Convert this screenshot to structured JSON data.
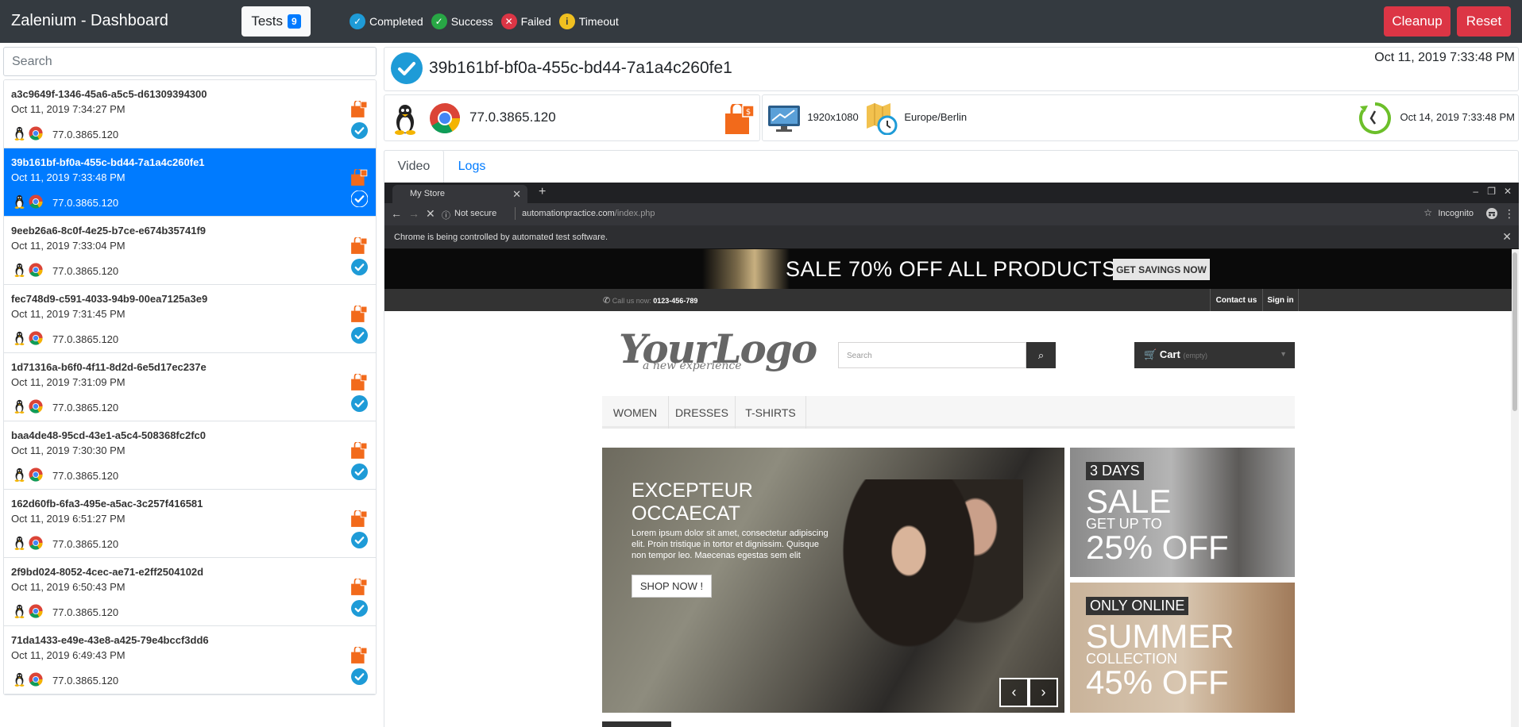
{
  "header": {
    "brand": "Zalenium - Dashboard",
    "tests_label": "Tests",
    "tests_count": "9",
    "legend": {
      "completed": "Completed",
      "success": "Success",
      "failed": "Failed",
      "timeout": "Timeout"
    },
    "cleanup_label": "Cleanup",
    "reset_label": "Reset"
  },
  "colors": {
    "navbar": "#343a40",
    "primary": "#007bff",
    "danger": "#dc3545",
    "success": "#28a745",
    "completed": "#1e9bd7",
    "timeout": "#f0c020"
  },
  "sidebar": {
    "search_placeholder": "Search",
    "tests": [
      {
        "id": "a3c9649f-1346-45a6-a5c5-d61309394300",
        "date": "Oct 11, 2019 7:34:27 PM",
        "version": "77.0.3865.120",
        "active": false
      },
      {
        "id": "39b161bf-bf0a-455c-bd44-7a1a4c260fe1",
        "date": "Oct 11, 2019 7:33:48 PM",
        "version": "77.0.3865.120",
        "active": true
      },
      {
        "id": "9eeb26a6-8c0f-4e25-b7ce-e674b35741f9",
        "date": "Oct 11, 2019 7:33:04 PM",
        "version": "77.0.3865.120",
        "active": false
      },
      {
        "id": "fec748d9-c591-4033-94b9-00ea7125a3e9",
        "date": "Oct 11, 2019 7:31:45 PM",
        "version": "77.0.3865.120",
        "active": false
      },
      {
        "id": "1d71316a-b6f0-4f11-8d2d-6e5d17ec237e",
        "date": "Oct 11, 2019 7:31:09 PM",
        "version": "77.0.3865.120",
        "active": false
      },
      {
        "id": "baa4de48-95cd-43e1-a5c4-508368fc2fc0",
        "date": "Oct 11, 2019 7:30:30 PM",
        "version": "77.0.3865.120",
        "active": false
      },
      {
        "id": "162d60fb-6fa3-495e-a5ac-3c257f416581",
        "date": "Oct 11, 2019 6:51:27 PM",
        "version": "77.0.3865.120",
        "active": false
      },
      {
        "id": "2f9bd024-8052-4cec-ae71-e2ff2504102d",
        "date": "Oct 11, 2019 6:50:43 PM",
        "version": "77.0.3865.120",
        "active": false
      },
      {
        "id": "71da1433-e49e-43e8-a425-79e4bccf3dd6",
        "date": "Oct 11, 2019 6:49:43 PM",
        "version": "77.0.3865.120",
        "active": false
      }
    ]
  },
  "detail": {
    "test_id": "39b161bf-bf0a-455c-bd44-7a1a4c260fe1",
    "start_time": "Oct 11, 2019 7:33:48 PM",
    "browser_version": "77.0.3865.120",
    "resolution": "1920x1080",
    "timezone": "Europe/Berlin",
    "retention_date": "Oct 14, 2019 7:33:48 PM",
    "tabs": {
      "video": "Video",
      "logs": "Logs"
    }
  },
  "video": {
    "chrome_tab_title": "My Store",
    "not_secure": "Not secure",
    "url_host": "automationpractice.com",
    "url_path": "/index.php",
    "incognito": "Incognito",
    "infobar": "Chrome is being controlled by automated test software.",
    "store": {
      "sale_text": "SALE 70% OFF ALL PRODUCTS",
      "sale_button": "GET SAVINGS NOW",
      "call_label": "Call us now:",
      "phone": "0123-456-789",
      "contact": "Contact us",
      "signin": "Sign in",
      "logo": "YourLogo",
      "logo_sub": "a new experience",
      "search_placeholder": "Search",
      "cart": "Cart",
      "cart_empty": "(empty)",
      "menu": [
        "WOMEN",
        "DRESSES",
        "T-SHIRTS"
      ],
      "slide_title_1": "EXCEPTEUR",
      "slide_title_2": "OCCAECAT",
      "slide_text": "Lorem ipsum dolor sit amet, consectetur adipiscing elit. Proin tristique in tortor et dignissim. Quisque non tempor leo. Maecenas egestas sem elit",
      "shop_now": "SHOP NOW !",
      "promo1": {
        "tag": "3 DAYS",
        "big": "SALE",
        "small": "GET UP TO",
        "pct": "25% OFF"
      },
      "promo2": {
        "tag": "ONLY ONLINE",
        "big": "SUMMER",
        "small": "COLLECTION",
        "pct": "45% OFF"
      }
    }
  }
}
